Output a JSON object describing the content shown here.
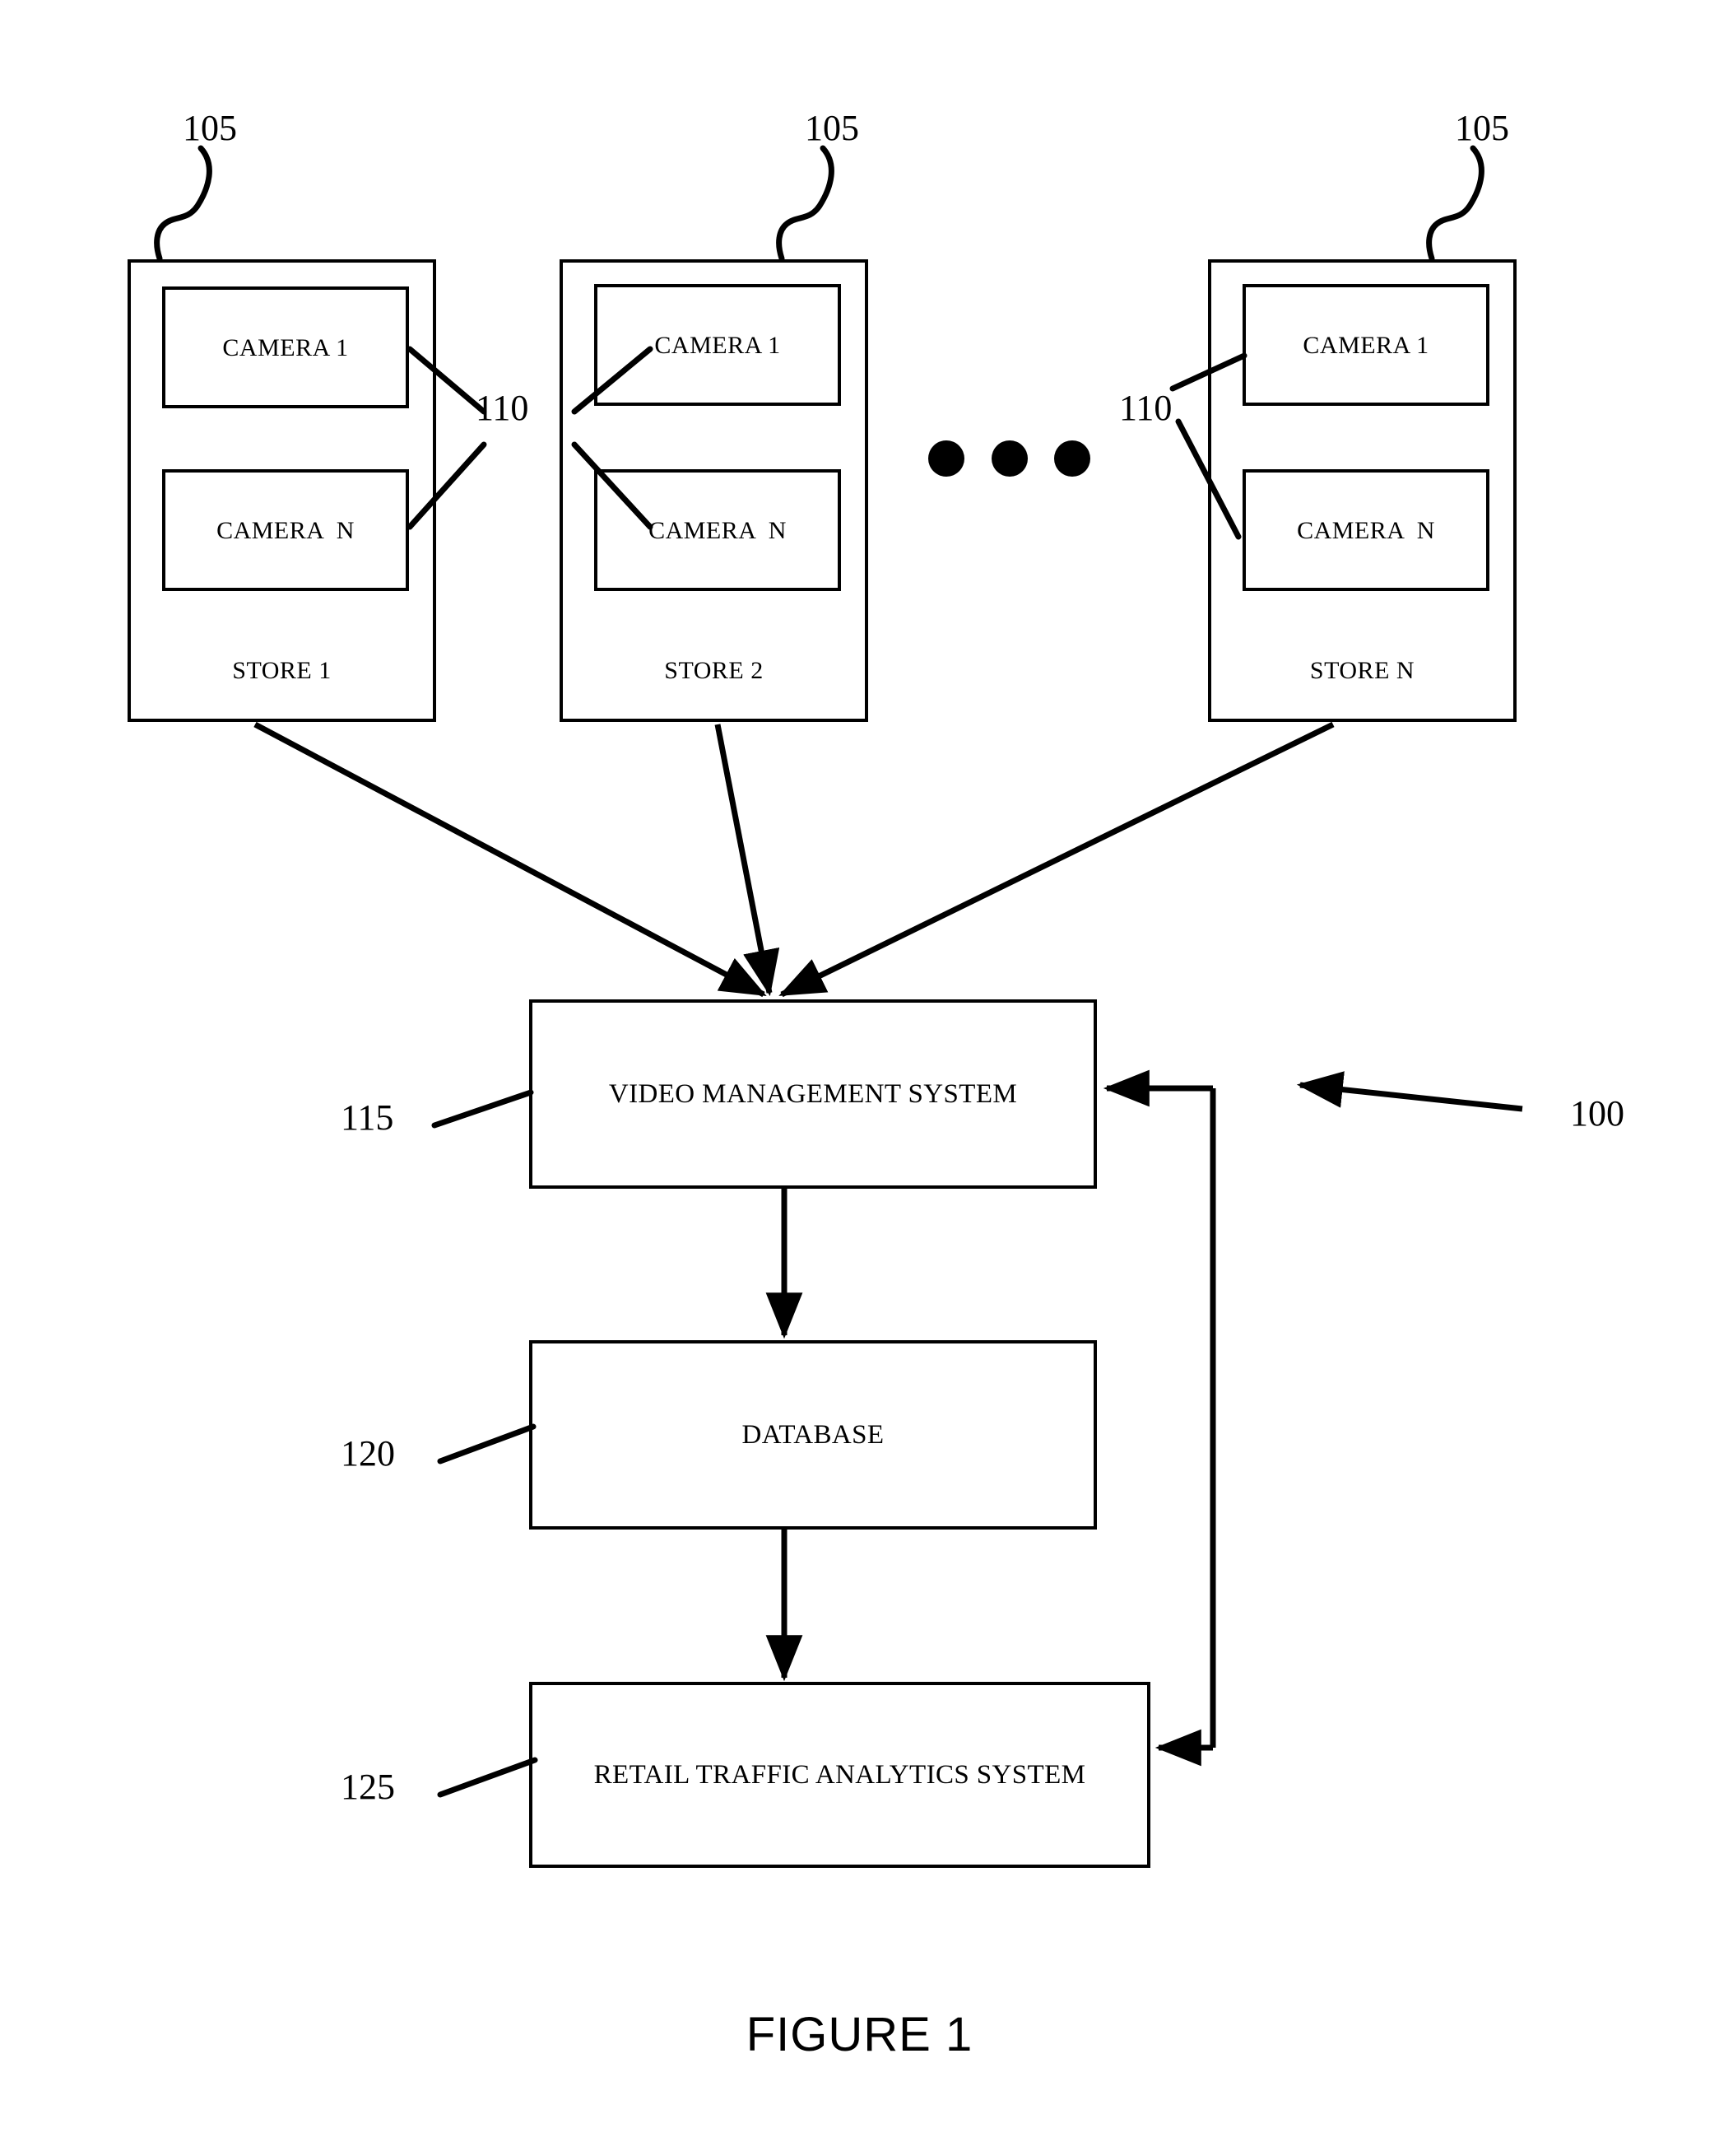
{
  "figure": {
    "caption": "FIGURE 1",
    "overall_ref": "100"
  },
  "stores": [
    {
      "ref": "105",
      "name": "STORE 1",
      "cameras": [
        {
          "label": "CAMERA 1"
        },
        {
          "label": "CAMERA  N"
        }
      ]
    },
    {
      "ref": "105",
      "name": "STORE 2",
      "cameras": [
        {
          "label": "CAMERA 1"
        },
        {
          "label": "CAMERA  N"
        }
      ]
    },
    {
      "ref": "105",
      "name": "STORE N",
      "cameras": [
        {
          "label": "CAMERA 1"
        },
        {
          "label": "CAMERA  N"
        }
      ]
    }
  ],
  "camera_group_refs": {
    "left": "110",
    "right": "110"
  },
  "ellipsis": {
    "dots": 3
  },
  "systems": [
    {
      "id": "vms",
      "ref": "115",
      "label": "VIDEO MANAGEMENT SYSTEM"
    },
    {
      "id": "database",
      "ref": "120",
      "label": "DATABASE"
    },
    {
      "id": "rtas",
      "ref": "125",
      "label": "RETAIL TRAFFIC ANALYTICS SYSTEM"
    }
  ],
  "colors": {
    "line": "#000000",
    "background": "#ffffff"
  }
}
